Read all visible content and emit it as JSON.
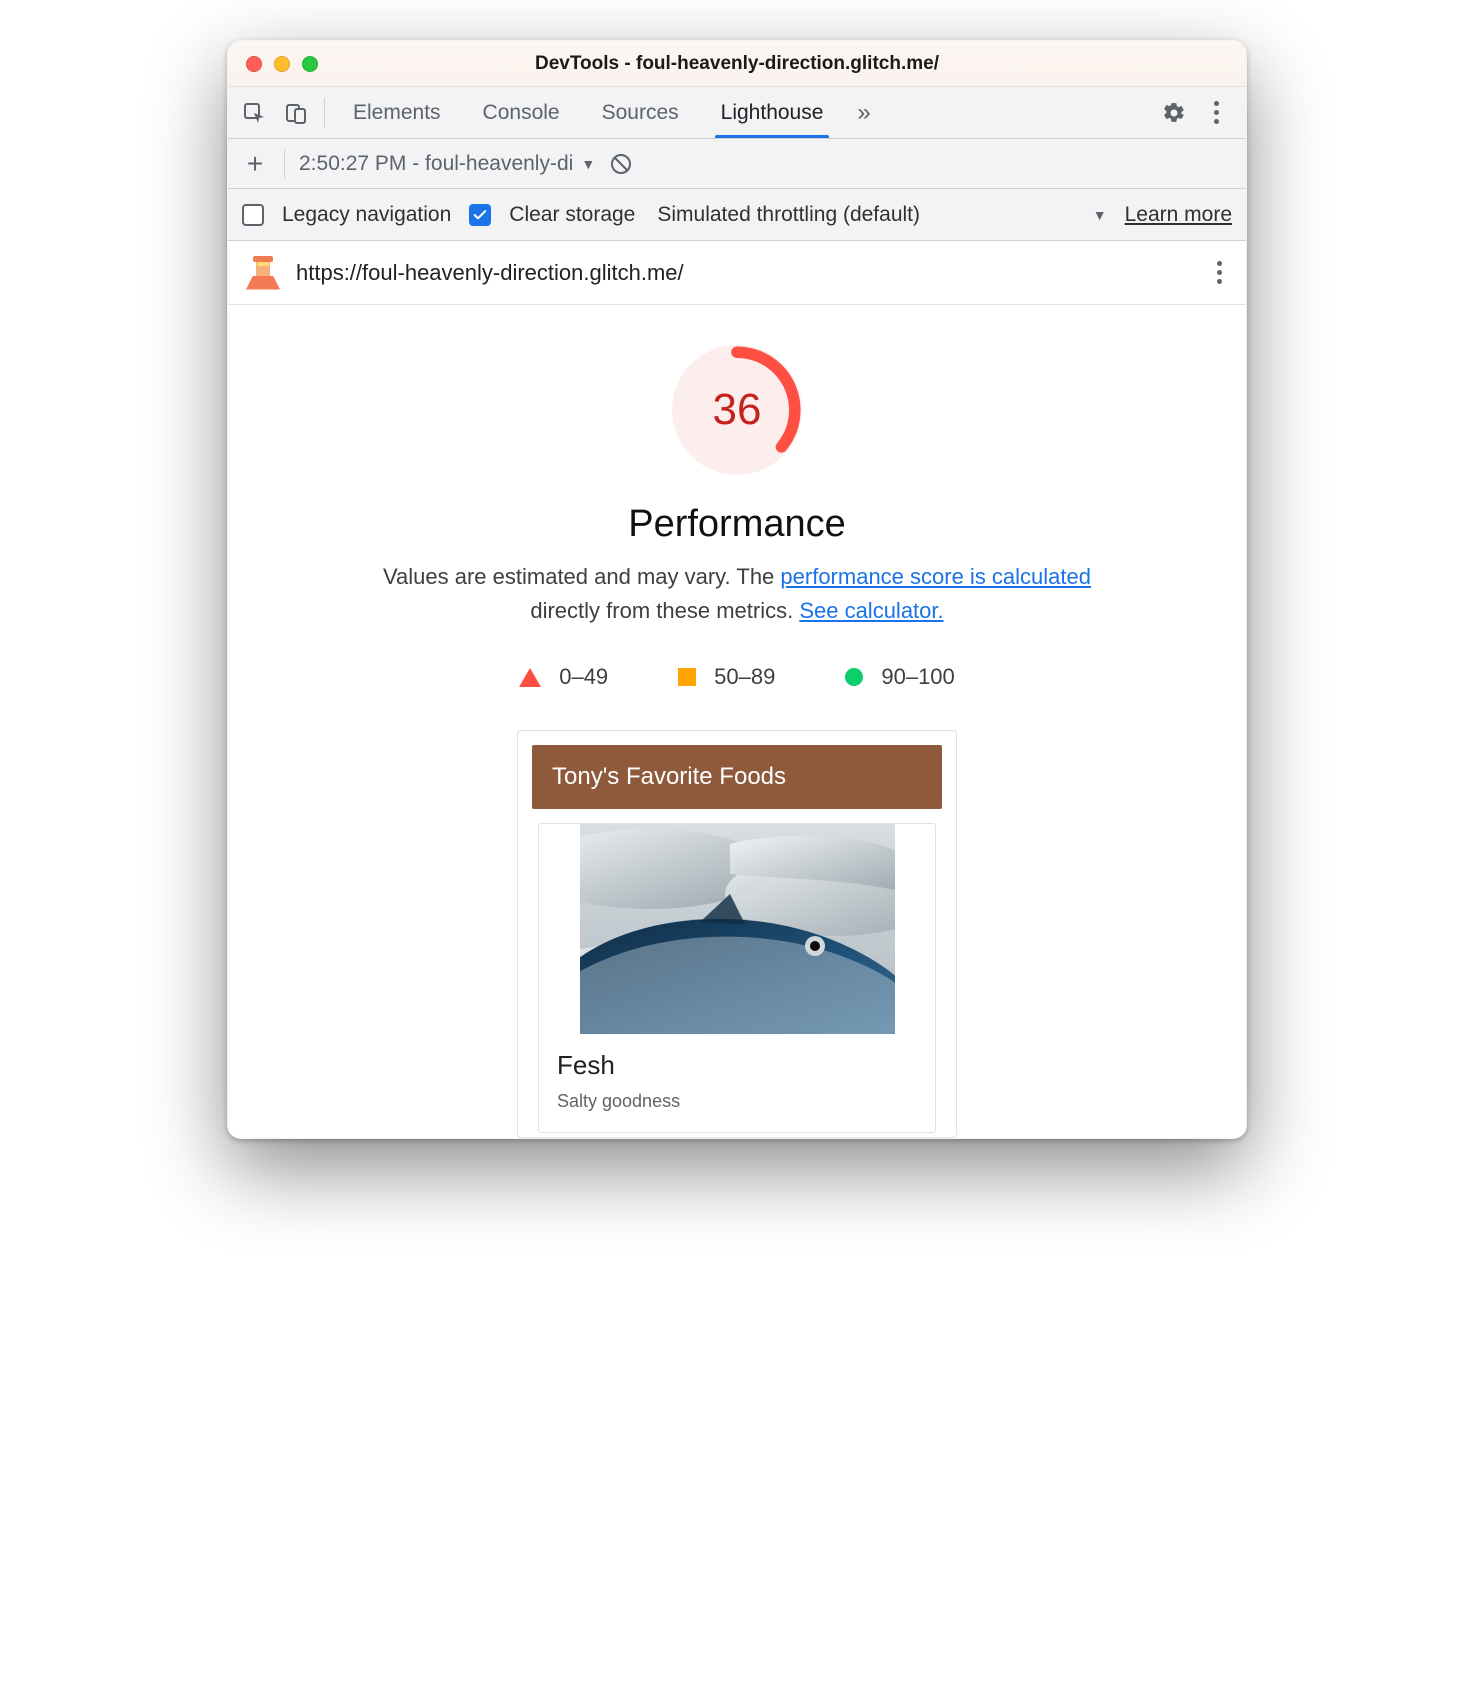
{
  "window": {
    "title": "DevTools - foul-heavenly-direction.glitch.me/"
  },
  "tabs": {
    "items": [
      "Elements",
      "Console",
      "Sources",
      "Lighthouse"
    ],
    "active": "Lighthouse"
  },
  "subtoolbar": {
    "dropdown_label": "2:50:27 PM - foul-heavenly-di"
  },
  "options": {
    "legacy_nav_label": "Legacy navigation",
    "legacy_nav_checked": false,
    "clear_storage_label": "Clear storage",
    "clear_storage_checked": true,
    "throttling_label": "Simulated throttling (default)",
    "learn_more": "Learn more"
  },
  "report": {
    "url": "https://foul-heavenly-direction.glitch.me/",
    "score": "36",
    "score_value": 36,
    "category": "Performance",
    "desc_prefix": "Values are estimated and may vary. The ",
    "desc_link1": "performance score is calculated",
    "desc_mid": " directly from these metrics. ",
    "desc_link2": "See calculator.",
    "legend": {
      "fail": "0–49",
      "avg": "50–89",
      "pass": "90–100"
    },
    "colors": {
      "fail": "#ff4e42",
      "avg": "#ffa400",
      "pass": "#0cce6b",
      "score_text": "#c5221f"
    }
  },
  "preview": {
    "header": "Tony's Favorite Foods",
    "card_title": "Fesh",
    "card_sub": "Salty goodness"
  }
}
